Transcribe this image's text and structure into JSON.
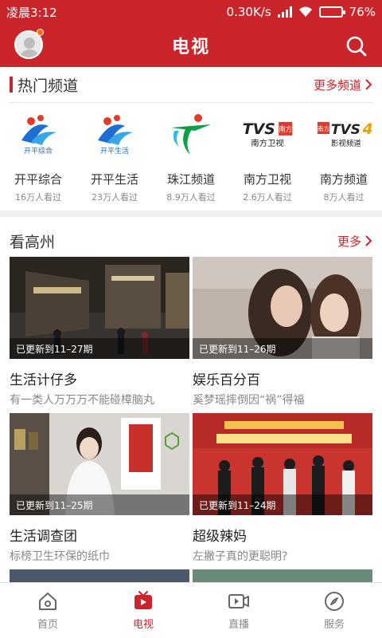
{
  "status_bar": {
    "time": "凌晨3:12",
    "speed": "0.30K/s",
    "battery": "76%",
    "battery_level": 0.76
  },
  "header": {
    "title": "电视",
    "avatar_icon": "avatar-icon",
    "search_icon": "search-icon"
  },
  "hot_channels": {
    "title": "热门频道",
    "more": "更多频道",
    "items": [
      {
        "name": "开平综合",
        "views": "16万人看过",
        "logo_text": "开平综合",
        "color": "#1e6fd1"
      },
      {
        "name": "开平生活",
        "views": "23万人看过",
        "logo_text": "开平生活",
        "color": "#1e6fd1"
      },
      {
        "name": "珠江频道",
        "views": "8.9万人看过",
        "logo_text": "",
        "color": "#0da04a"
      },
      {
        "name": "南方卫视",
        "views": "2.6万人看过",
        "logo_text": "南方卫视",
        "color": "#222222"
      },
      {
        "name": "南方频道",
        "views": "8万人看过",
        "logo_text": "影视频道",
        "color": "#222222"
      }
    ]
  },
  "local": {
    "title": "看高州",
    "more": "更多",
    "programs": [
      {
        "caption": "已更新到11–27期",
        "title": "生活计仔多",
        "desc": "有一类人万万万不能碰樟脑丸"
      },
      {
        "caption": "已更新到11–26期",
        "title": "娱乐百分百",
        "desc": "奚梦瑶摔倒因“祸”得福"
      },
      {
        "caption": "已更新到11–25期",
        "title": "生活调查团",
        "desc": "标榜卫生环保的纸巾"
      },
      {
        "caption": "已更新到11–24期",
        "title": "超级辣妈",
        "desc": "左撇子真的更聪明?"
      }
    ]
  },
  "bottom_nav": [
    {
      "label": "首页",
      "icon": "home-icon"
    },
    {
      "label": "电视",
      "icon": "tv-icon",
      "active": true
    },
    {
      "label": "直播",
      "icon": "live-icon"
    },
    {
      "label": "服务",
      "icon": "compass-icon"
    }
  ],
  "colors": {
    "brand": "#c9252b"
  }
}
